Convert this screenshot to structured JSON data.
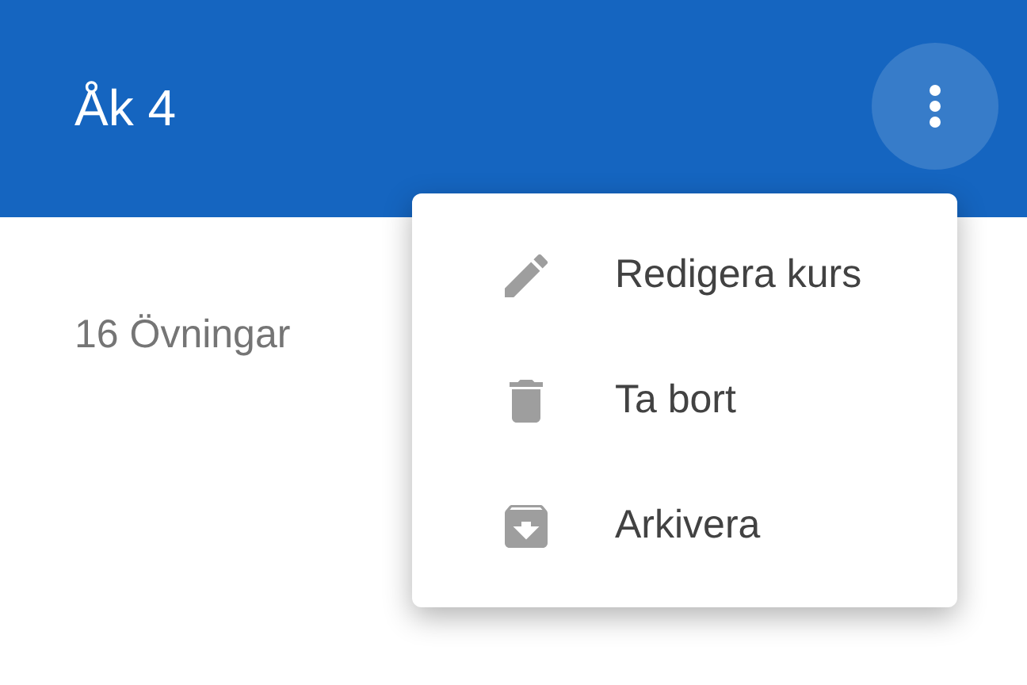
{
  "app_bar": {
    "title": "Åk 4"
  },
  "content": {
    "count": "16 Övningar"
  },
  "menu": {
    "items": [
      {
        "kind": "edit",
        "label": "Redigera kurs"
      },
      {
        "kind": "delete",
        "label": "Ta bort"
      },
      {
        "kind": "archive",
        "label": "Arkivera"
      }
    ]
  }
}
